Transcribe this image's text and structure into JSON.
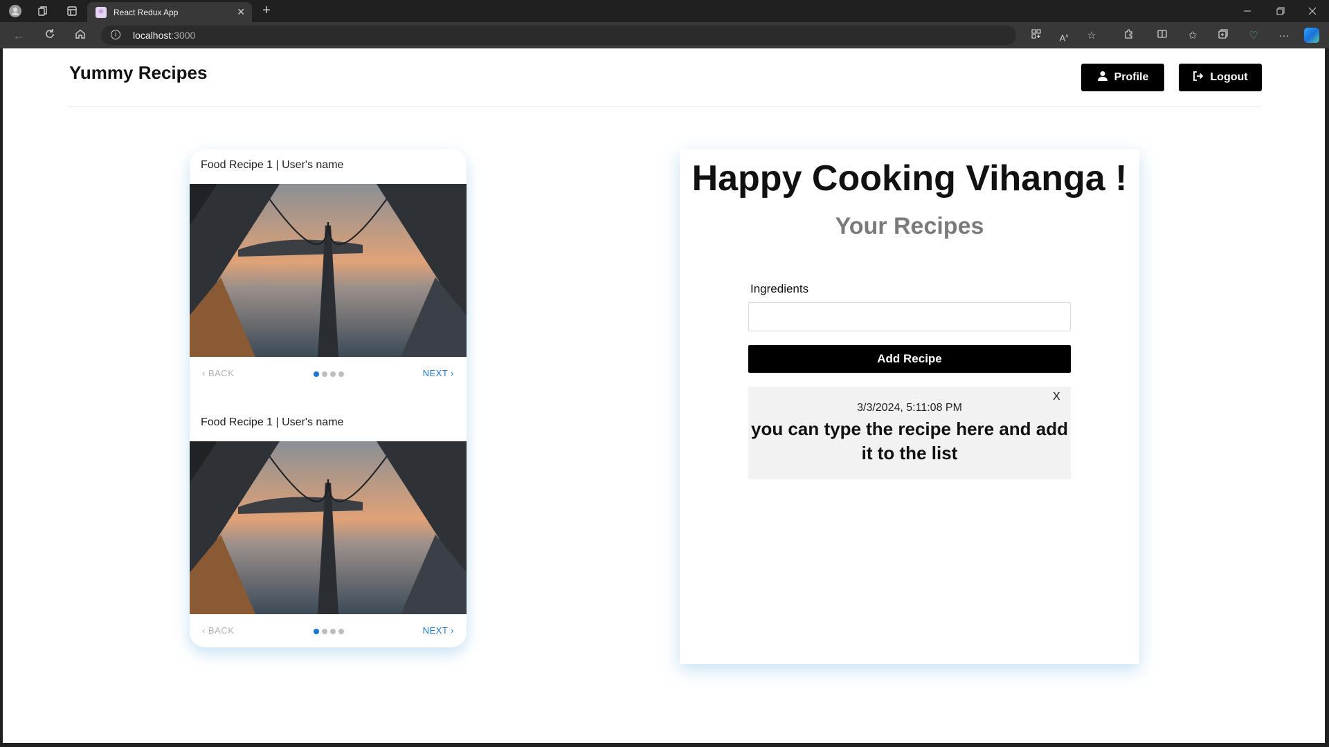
{
  "browser": {
    "tab_title": "React Redux App",
    "tab_close": "✕",
    "new_tab": "+",
    "url_host": "localhost",
    "url_port": ":3000",
    "icons": [
      "profile-icon",
      "workspaces-icon",
      "tab-actions-icon",
      "back-icon",
      "refresh-icon",
      "home-icon",
      "site-info-icon",
      "app-available-icon",
      "read-aloud-icon",
      "favorite-star-icon",
      "extensions-icon",
      "split-screen-icon",
      "favorites-icon",
      "collections-icon",
      "browser-essentials-icon",
      "more-icon",
      "copilot-icon"
    ]
  },
  "header": {
    "brand": "Yummy Recipes",
    "profile_label": "Profile",
    "logout_label": "Logout"
  },
  "carousel": {
    "slides": [
      {
        "title": "Food Recipe 1 | User's name",
        "back_label": "BACK",
        "next_label": "NEXT",
        "active_step": 1,
        "steps": 4
      },
      {
        "title": "Food Recipe 1 | User's name",
        "back_label": "BACK",
        "next_label": "NEXT",
        "active_step": 1,
        "steps": 4
      }
    ]
  },
  "main": {
    "greeting": "Happy Cooking Vihanga !",
    "section_title": "Your Recipes",
    "ingredients_label": "Ingredients",
    "ingredients_value": "",
    "add_button": "Add Recipe",
    "recipes": [
      {
        "date": "3/3/2024, 5:11:08 PM",
        "text": "you can type the recipe here and add it to the list",
        "delete_label": "X"
      }
    ]
  },
  "colors": {
    "accent": "#1976d2",
    "button_bg": "#000000",
    "card_shadow": "#5aaadc"
  }
}
